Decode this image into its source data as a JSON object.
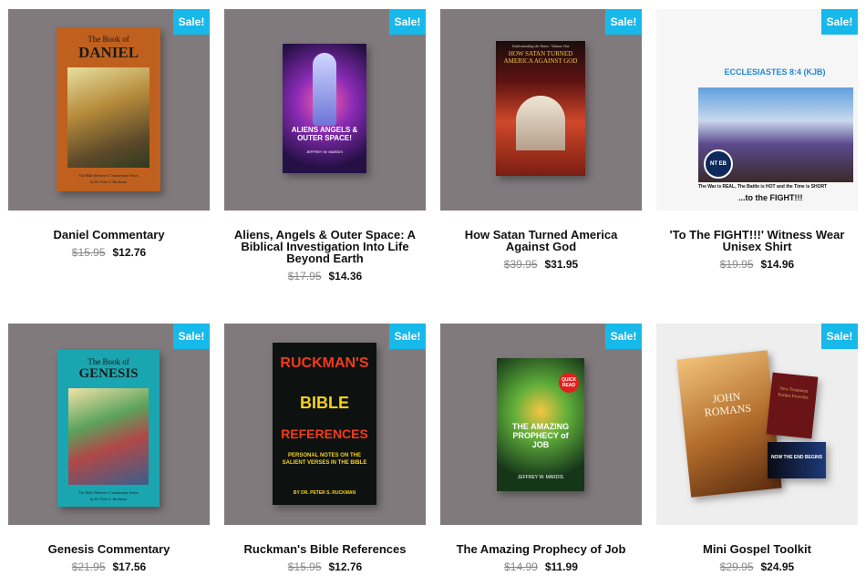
{
  "sale_label": "Sale!",
  "colors": {
    "sale_badge": "#17b9ea",
    "thumb_bg": "#807a7d",
    "thumb_bg_light": "#eeeeee"
  },
  "products": [
    {
      "title": "Daniel Commentary",
      "old_price": "$15.95",
      "new_price": "$12.76",
      "cover": {
        "top": "The Book of",
        "main": "DANIEL",
        "foot": "The Bible Believer's Commentary Series",
        "author": "by Dr. Peter S. Ruckman"
      }
    },
    {
      "title": "Aliens, Angels & Outer Space: A Biblical Investigation Into Life Beyond Earth",
      "old_price": "$17.95",
      "new_price": "$14.36",
      "cover": {
        "main": "ALIENS ANGELS & OUTER SPACE!",
        "author": "JEFFREY W. MARDIS"
      }
    },
    {
      "title": "How Satan Turned America Against God",
      "old_price": "$39.95",
      "new_price": "$31.95",
      "cover": {
        "top": "Understanding the Times - Volume One",
        "main": "HOW SATAN TURNED AMERICA AGAINST GOD"
      }
    },
    {
      "title": "'To The FIGHT!!!' Witness Wear Unisex Shirt",
      "old_price": "$19.95",
      "new_price": "$14.96",
      "cover": {
        "verse": "ECCLESIASTES 8:4 (KJB)",
        "badge": "NT EB",
        "line1": "The War is REAL, The Battle is HOT and the Time is SHORT",
        "line2": "...to the FIGHT!!!"
      }
    },
    {
      "title": "Genesis Commentary",
      "old_price": "$21.95",
      "new_price": "$17.56",
      "cover": {
        "top": "The Book of",
        "main": "GENESIS",
        "foot": "The Bible Believer's Commentary Series",
        "author": "by Dr. Peter S. Ruckman"
      }
    },
    {
      "title": "Ruckman's Bible References",
      "old_price": "$15.95",
      "new_price": "$12.76",
      "cover": {
        "main1": "RUCKMAN'S",
        "main2": "BIBLE",
        "main3": "REFERENCES",
        "sub": "PERSONAL NOTES ON THE SALIENT VERSES IN THE BIBLE",
        "author": "BY DR. PETER S. RUCKMAN"
      }
    },
    {
      "title": "The Amazing Prophecy of Job",
      "old_price": "$14.99",
      "new_price": "$11.99",
      "cover": {
        "main": "THE AMAZING PROPHECY of JOB",
        "badge": "QUICK READ",
        "author": "JEFFREY W. MARDIS"
      }
    },
    {
      "title": "Mini Gospel Toolkit",
      "old_price": "$29.95",
      "new_price": "$24.95",
      "cover": {
        "main": "JOHN ROMANS",
        "bible": "New Testament Psalms Proverbs",
        "tract": "NOW THE END BEGINS"
      }
    }
  ]
}
